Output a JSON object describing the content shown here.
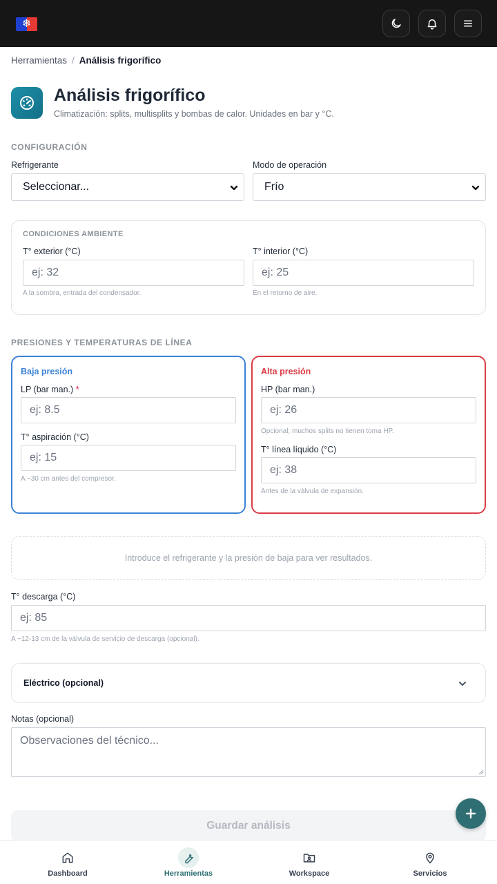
{
  "colors": {
    "topbar": "#161616",
    "accent": "#2f6f74",
    "header_icon": "#1a8096",
    "low_pressure": "#3b82d6",
    "high_pressure": "#dc3b45"
  },
  "topbar": {
    "logo_icon": "snowflake-icon",
    "buttons": [
      "moon-icon",
      "bell-icon",
      "menu-icon"
    ]
  },
  "breadcrumb": {
    "parent": "Herramientas",
    "separator": "/",
    "current": "Análisis frigorífico"
  },
  "header": {
    "icon": "gauge-icon",
    "title": "Análisis frigorífico",
    "subtitle": "Climatización: splits, multisplits y bombas de calor. Unidades en bar y °C."
  },
  "config": {
    "section_title": "CONFIGURACIÓN",
    "refrigerant": {
      "label": "Refrigerante",
      "value": "Seleccionar..."
    },
    "mode": {
      "label": "Modo de operación",
      "value": "Frío"
    }
  },
  "ambient": {
    "title": "CONDICIONES AMBIENTE",
    "outdoor": {
      "label": "T° exterior (°C)",
      "placeholder": "ej: 32",
      "hint": "A la sombra, entrada del condensador."
    },
    "indoor": {
      "label": "T° interior (°C)",
      "placeholder": "ej: 25",
      "hint": "En el retorno de aire."
    }
  },
  "lines": {
    "section_title": "PRESIONES Y TEMPERATURAS DE LÍNEA",
    "low": {
      "title": "Baja presión",
      "lp": {
        "label": "LP (bar man.)",
        "required": "*",
        "placeholder": "ej: 8.5"
      },
      "suction": {
        "label": "T° aspiración (°C)",
        "placeholder": "ej: 15",
        "hint": "A ~30 cm antes del compresor."
      }
    },
    "high": {
      "title": "Alta presión",
      "hp": {
        "label": "HP (bar man.)",
        "placeholder": "ej: 26",
        "hint": "Opcional; muchos splits no tienen toma HP."
      },
      "liquid": {
        "label": "T° línea líquido (°C)",
        "placeholder": "ej: 38",
        "hint": "Antes de la válvula de expansión."
      }
    }
  },
  "results_placeholder": "Introduce el refrigerante y la presión de baja para ver resultados.",
  "discharge": {
    "label": "T° descarga (°C)",
    "placeholder": "ej: 85",
    "hint": "A ~12-13 cm de la válvula de servicio de descarga (opcional)."
  },
  "electric": {
    "title": "Eléctrico (opcional)"
  },
  "notes": {
    "label": "Notas (opcional)",
    "placeholder": "Observaciones del técnico..."
  },
  "save_label": "Guardar análisis",
  "nav": [
    {
      "label": "Dashboard",
      "icon": "home-icon"
    },
    {
      "label": "Herramientas",
      "icon": "wrench-icon",
      "active": true
    },
    {
      "label": "Workspace",
      "icon": "folder-user-icon"
    },
    {
      "label": "Servicios",
      "icon": "map-pin-icon"
    }
  ]
}
